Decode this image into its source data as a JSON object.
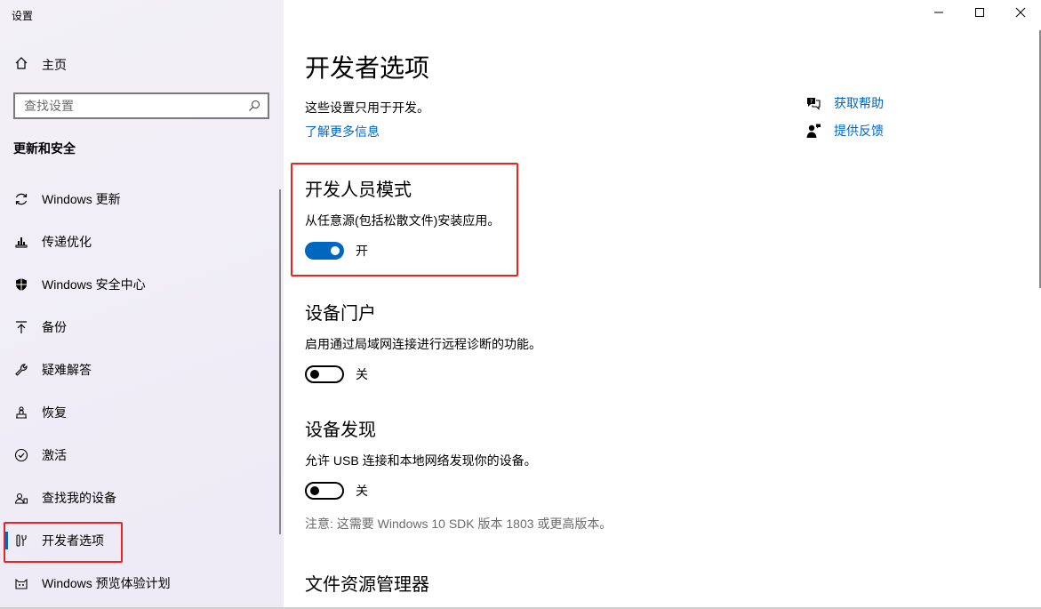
{
  "window": {
    "title": "设置",
    "controls": {
      "minimize": "minimize-icon",
      "maximize": "maximize-icon",
      "close": "close-icon"
    }
  },
  "sidebar": {
    "home_label": "主页",
    "search_placeholder": "查找设置",
    "section_header": "更新和安全",
    "items": [
      {
        "label": "Windows 更新",
        "icon": "sync-icon"
      },
      {
        "label": "传递优化",
        "icon": "delivery-optimization-icon"
      },
      {
        "label": "Windows 安全中心",
        "icon": "shield-icon"
      },
      {
        "label": "备份",
        "icon": "backup-arrow-icon"
      },
      {
        "label": "疑难解答",
        "icon": "wrench-icon"
      },
      {
        "label": "恢复",
        "icon": "recovery-icon"
      },
      {
        "label": "激活",
        "icon": "activation-check-icon"
      },
      {
        "label": "查找我的设备",
        "icon": "find-device-icon"
      },
      {
        "label": "开发者选项",
        "icon": "developer-tools-icon",
        "active": true
      },
      {
        "label": "Windows 预览体验计划",
        "icon": "insider-cat-icon"
      }
    ]
  },
  "main": {
    "title": "开发者选项",
    "description": "这些设置只用于开发。",
    "learn_more": "了解更多信息",
    "help": {
      "get_help": "获取帮助",
      "feedback": "提供反馈"
    },
    "sections": {
      "dev_mode": {
        "heading": "开发人员模式",
        "text": "从任意源(包括松散文件)安装应用。",
        "state": "开",
        "on": true
      },
      "device_portal": {
        "heading": "设备门户",
        "text": "启用通过局域网连接进行远程诊断的功能。",
        "state": "关",
        "on": false
      },
      "device_discovery": {
        "heading": "设备发现",
        "text": "允许 USB 连接和本地网络发现你的设备。",
        "state": "关",
        "on": false
      },
      "note": "注意: 这需要 Windows 10 SDK 版本 1803 或更高版本。",
      "file_explorer": {
        "heading": "文件资源管理器"
      }
    }
  },
  "colors": {
    "accent": "#0067c0",
    "highlight_border": "#e82525",
    "sidebar_bg": "#f1eef7"
  }
}
